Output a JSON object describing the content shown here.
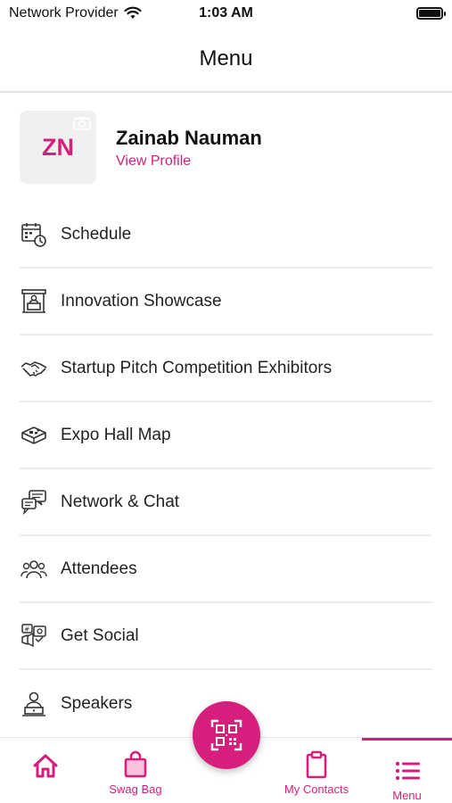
{
  "status_bar": {
    "carrier": "Network Provider",
    "time": "1:03 AM"
  },
  "header": {
    "title": "Menu"
  },
  "profile": {
    "initials": "ZN",
    "name": "Zainab Nauman",
    "link_label": "View Profile"
  },
  "menu": {
    "items": [
      {
        "label": "Schedule",
        "icon": "calendar-clock-icon"
      },
      {
        "label": "Innovation Showcase",
        "icon": "booth-icon"
      },
      {
        "label": "Startup Pitch Competition Exhibitors",
        "icon": "handshake-icon"
      },
      {
        "label": "Expo Hall Map",
        "icon": "map-icon"
      },
      {
        "label": "Network & Chat",
        "icon": "chat-icon"
      },
      {
        "label": "Attendees",
        "icon": "people-icon"
      },
      {
        "label": "Get Social",
        "icon": "social-icon"
      },
      {
        "label": "Speakers",
        "icon": "speaker-podium-icon"
      }
    ]
  },
  "tabbar": {
    "home_label": "",
    "swag_label": "Swag Bag",
    "contacts_label": "My Contacts",
    "menu_label": "Menu",
    "scan_icon": "qr-scan-icon"
  },
  "colors": {
    "accent": "#d61f7c",
    "text": "#222222",
    "divider": "#ececec",
    "avatar_bg": "#f0f0f0"
  }
}
